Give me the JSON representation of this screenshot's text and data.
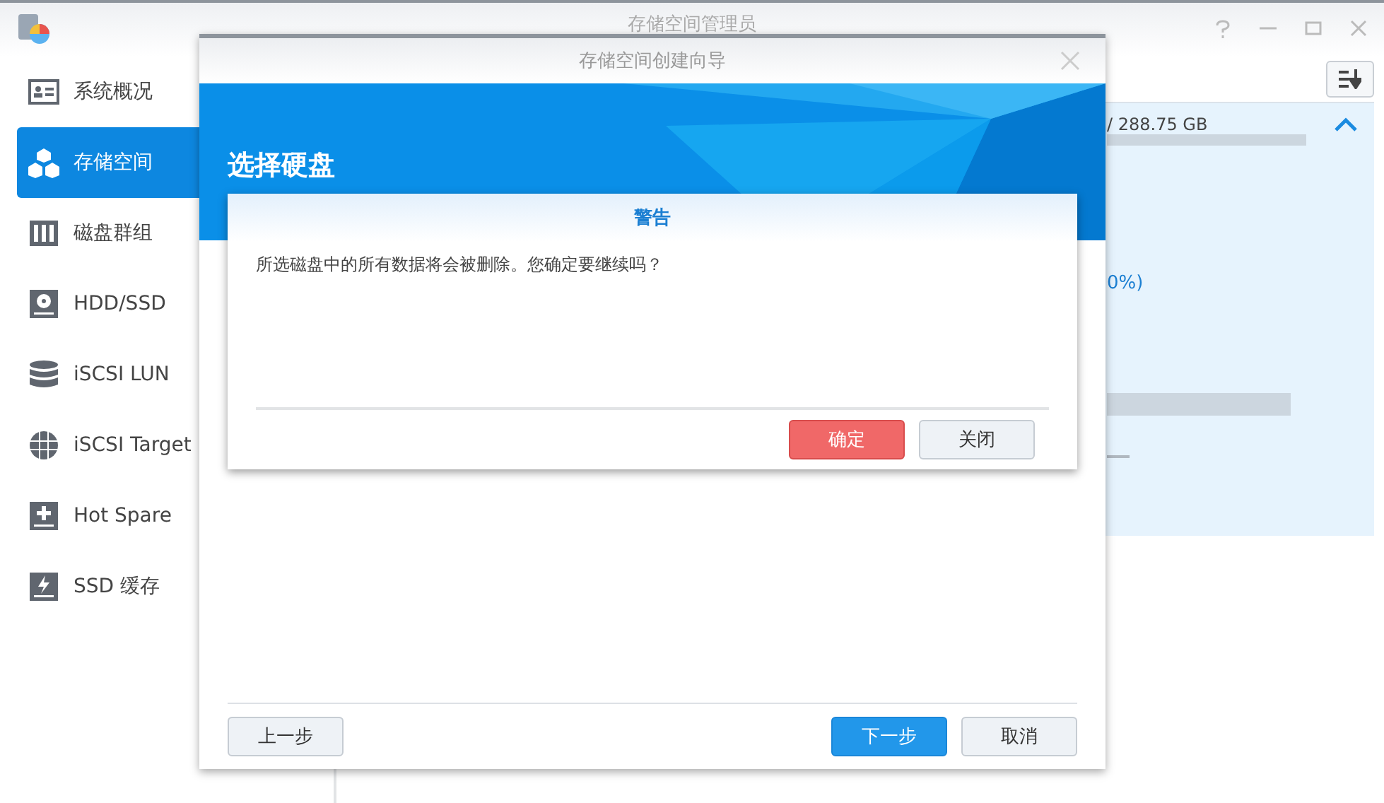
{
  "window": {
    "title": "存储空间管理员"
  },
  "sidebar": {
    "items": [
      {
        "label": "系统概况",
        "selected": false
      },
      {
        "label": "存储空间",
        "selected": true
      },
      {
        "label": "磁盘群组",
        "selected": false
      },
      {
        "label": "HDD/SSD",
        "selected": false
      },
      {
        "label": "iSCSI LUN",
        "selected": false
      },
      {
        "label": "iSCSI Target",
        "selected": false
      },
      {
        "label": "Hot Spare",
        "selected": false
      },
      {
        "label": "SSD 缓存",
        "selected": false
      }
    ]
  },
  "volume_card": {
    "capacity_text": "/ 288.75 GB",
    "percent_text": "0%)",
    "expanded": true
  },
  "wizard": {
    "title": "存储空间创建向导",
    "step_title": "选择硬盘",
    "buttons": [
      {
        "label": "上一步",
        "kind": "default"
      },
      {
        "label": "下一步",
        "kind": "primary"
      },
      {
        "label": "取消",
        "kind": "default"
      }
    ]
  },
  "alert": {
    "title": "警告",
    "message": "所选磁盘中的所有数据将会被删除。您确定要继续吗？",
    "buttons": [
      {
        "label": "确定",
        "kind": "danger"
      },
      {
        "label": "关闭",
        "kind": "default"
      }
    ]
  }
}
